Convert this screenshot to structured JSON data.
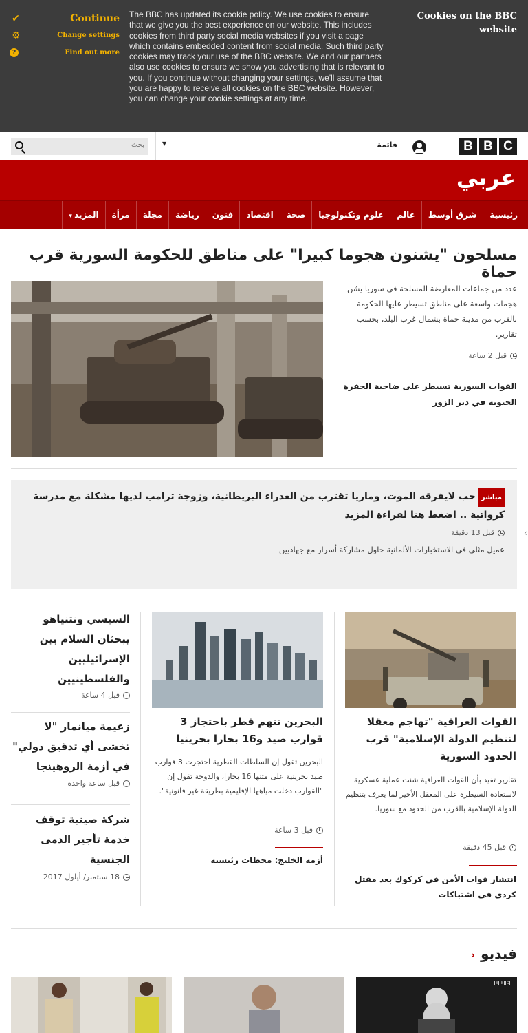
{
  "cookie": {
    "continue": "Continue",
    "change_settings": "Change settings",
    "find_out_more": "Find out more",
    "text": "The BBC has updated its cookie policy. We use cookies to ensure that we give you the best experience on our website. This includes cookies from third party social media websites if you visit a page which contains embedded content from social media. Such third party cookies may track your use of the BBC website. We and our partners also use cookies to ensure we show you advertising that is relevant to you. If you continue without changing your settings, we'll assume that you are happy to receive all cookies on the BBC website. However, you can change your cookie settings at any time.",
    "title": "Cookies on the BBC website"
  },
  "topbar": {
    "logo": [
      "B",
      "B",
      "C"
    ],
    "menu": "قائمة",
    "search_placeholder": "بحث"
  },
  "masthead": {
    "brand": "عربي"
  },
  "nav": [
    "رئيسية",
    "شرق أوسط",
    "عالم",
    "علوم وتكنولوجيا",
    "صحة",
    "اقتصاد",
    "فنون",
    "رياضة",
    "مجلة",
    "مرأة",
    "المزيد"
  ],
  "top_story": {
    "headline": "مسلحون \"يشنون هجوما كبيرا\" على مناطق للحكومة السورية قرب حماة",
    "summary": "عدد من جماعات المعارضة المسلحة في سوريا يشن هجمات واسعة على مناطق تسيطر عليها الحكومة بالقرب من مدينة حماة بشمال غرب البلد، بحسب تقارير.",
    "time": "قبل 2 ساعة",
    "related": "القوات السورية تسيطر على ضاحية الجفرة الحيوية في دير الزور"
  },
  "live": {
    "badge": "مباشر",
    "title": "حب لايفرقه الموت، وماريا تقترب من العذراء البريطانية، وزوجة ترامب لديها مشكلة مع مدرسة كرواتية .. اضغط هنا لقراءة المزيد",
    "time": "قبل 13 دقيقة",
    "sub": "عميل مثلي في الاستخبارات الألمانية حاول مشاركة أسرار مع جهاديين"
  },
  "col_right": {
    "title": "القوات العراقية \"تهاجم معقلا لتنظيم الدولة الإسلامية\" قرب الحدود السورية",
    "summary": "تقارير تفيد بأن القوات العراقية شنت عملية عسكرية لاستعادة السيطرة على المعقل الأخير لما يعرف بتنظيم الدولة الإسلامية بالقرب من الحدود مع سوريا.",
    "time": "قبل 45 دقيقة",
    "related": "انتشار قوات الأمن في كركوك بعد مقتل كردي في اشتباكات"
  },
  "col_mid": {
    "title": "البحرين تتهم قطر باحتجاز 3 قوارب صيد و16 بحارا بحرينيا",
    "summary": "البحرين تقول إن السلطات القطرية احتجزت 3 قوارب صيد بحرينية على متنها 16 بحارا، والدوحة تقول إن \"القوارب دخلت مياهها الإقليمية بطريقة غير قانونية\".",
    "time": "قبل 3 ساعة",
    "related": "أزمة الخليج: محطات رئيسية"
  },
  "col_left": [
    {
      "title": "السيسي ونتنياهو يبحثان السلام بين الإسرائيليين والفلسطينيين",
      "time": "قبل 4 ساعة"
    },
    {
      "title": "زعيمة ميانمار \"لا تخشى أي تدقيق دولي\" في أزمة الروهينجا",
      "time": "قبل ساعة واحدة"
    },
    {
      "title": "شركة صينية توقف خدمة تأجير الدمى الجنسية",
      "time": "18 سبتمبر/ أيلول 2017"
    }
  ],
  "video": {
    "title": "فيديو"
  }
}
